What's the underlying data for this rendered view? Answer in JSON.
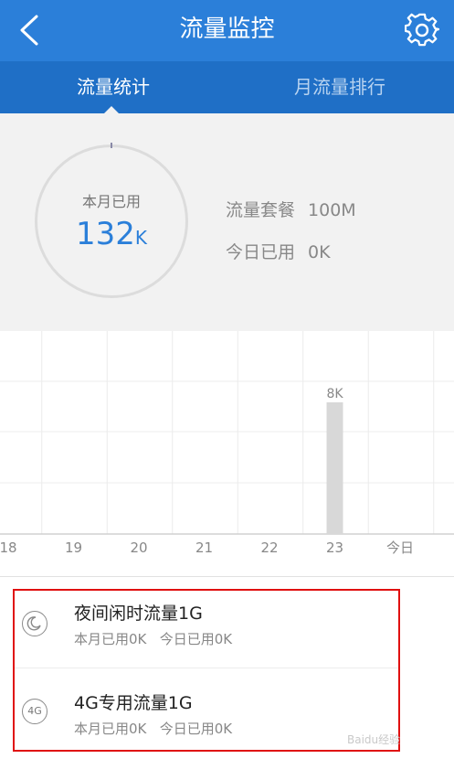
{
  "header": {
    "title": "流量监控",
    "back_icon": "chevron-left-icon",
    "settings_icon": "gear-icon"
  },
  "tabs": [
    {
      "label": "流量统计",
      "active": true
    },
    {
      "label": "月流量排行",
      "active": false
    }
  ],
  "summary": {
    "ring_label": "本月已用",
    "used_value": "132",
    "used_unit": "K",
    "plan_label": "流量套餐",
    "plan_value": "100M",
    "today_label": "今日已用",
    "today_value": "0K"
  },
  "chart_data": {
    "type": "bar",
    "categories": [
      "18",
      "19",
      "20",
      "21",
      "22",
      "23",
      "今日"
    ],
    "values": [
      0,
      0,
      0,
      0,
      0,
      8,
      0
    ],
    "value_labels": [
      "",
      "",
      "",
      "",
      "",
      "8K",
      ""
    ],
    "ylim": [
      0,
      10
    ],
    "grid": true
  },
  "packages": [
    {
      "icon": "moon-icon",
      "name": "夜间闲时流量1G",
      "month_used": "本月已用0K",
      "today_used": "今日已用0K"
    },
    {
      "icon": "4g-icon",
      "icon_text": "4G",
      "name": "4G专用流量1G",
      "month_used": "本月已用0K",
      "today_used": "今日已用0K"
    }
  ],
  "watermark": "Baidu经验",
  "colors": {
    "header": "#2b7fd9",
    "tabs": "#1f6fc6",
    "accent": "#2b7fd9",
    "bar": "#d8d8d8",
    "highlight_border": "#e01010"
  }
}
